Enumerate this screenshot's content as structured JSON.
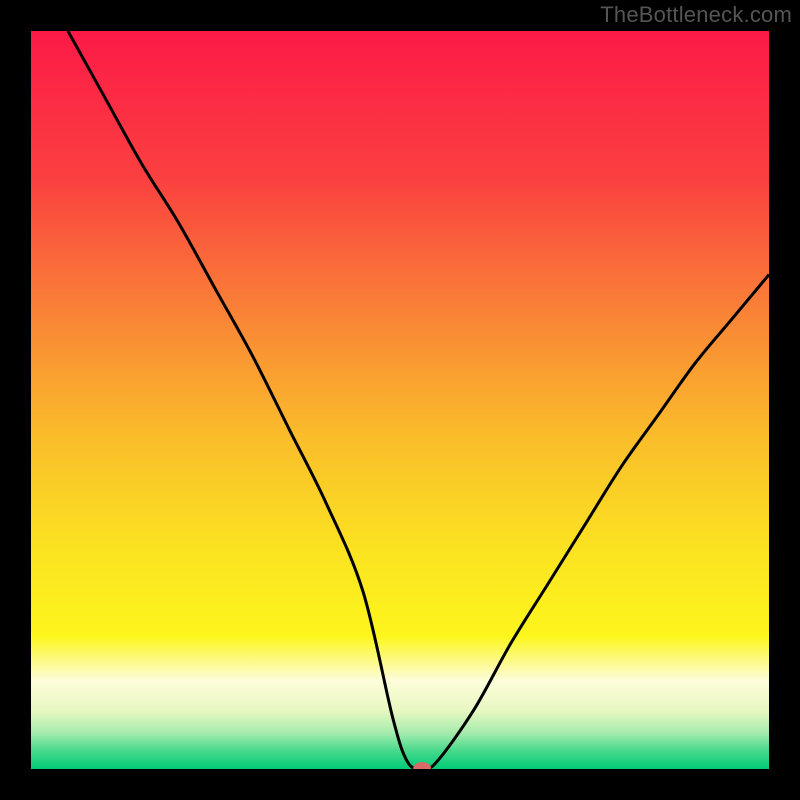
{
  "watermark": "TheBottleneck.com",
  "chart_data": {
    "type": "line",
    "title": "",
    "xlabel": "",
    "ylabel": "",
    "xlim": [
      0,
      100
    ],
    "ylim": [
      0,
      100
    ],
    "grid": false,
    "legend": false,
    "marker": {
      "x": 53,
      "y": 0,
      "color": "#d96a6a"
    },
    "series": [
      {
        "name": "bottleneck-curve",
        "color": "#000000",
        "x": [
          5,
          10,
          15,
          20,
          25,
          30,
          35,
          40,
          45,
          49,
          51,
          53,
          55,
          60,
          65,
          70,
          75,
          80,
          85,
          90,
          95,
          100
        ],
        "y": [
          100,
          91,
          82,
          74,
          65,
          56,
          46,
          36,
          24,
          7,
          1,
          0,
          1,
          8,
          17,
          25,
          33,
          41,
          48,
          55,
          61,
          67
        ]
      }
    ],
    "background_gradient": {
      "stops": [
        {
          "pos": 0.0,
          "color": "#fc1a47"
        },
        {
          "pos": 0.2,
          "color": "#fb4040"
        },
        {
          "pos": 0.4,
          "color": "#f98935"
        },
        {
          "pos": 0.55,
          "color": "#fabd2a"
        },
        {
          "pos": 0.7,
          "color": "#fbe221"
        },
        {
          "pos": 0.82,
          "color": "#fcf61c"
        },
        {
          "pos": 0.88,
          "color": "#fdfdda"
        },
        {
          "pos": 0.92,
          "color": "#e9f8c2"
        },
        {
          "pos": 0.95,
          "color": "#a8ecae"
        },
        {
          "pos": 0.975,
          "color": "#49d98c"
        },
        {
          "pos": 1.0,
          "color": "#00cc77"
        }
      ]
    }
  }
}
